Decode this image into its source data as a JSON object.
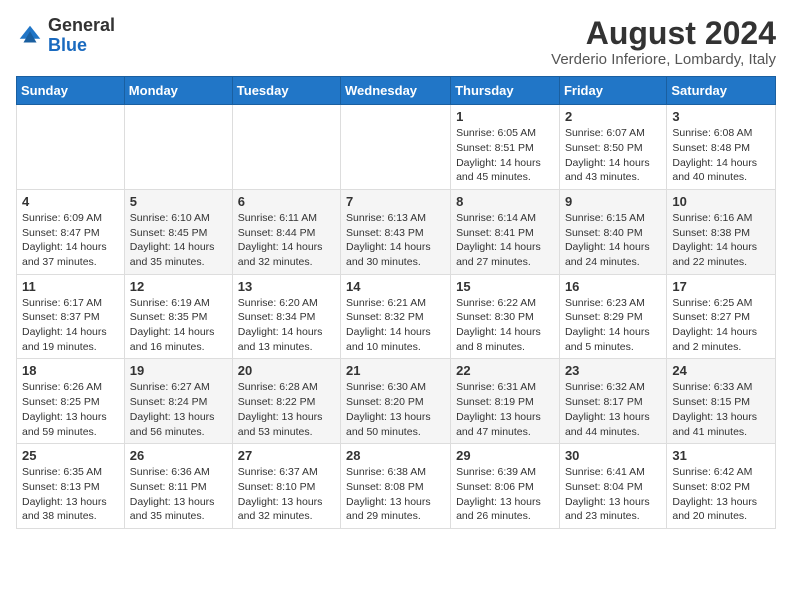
{
  "logo": {
    "text_general": "General",
    "text_blue": "Blue"
  },
  "header": {
    "month_year": "August 2024",
    "location": "Verderio Inferiore, Lombardy, Italy"
  },
  "weekdays": [
    "Sunday",
    "Monday",
    "Tuesday",
    "Wednesday",
    "Thursday",
    "Friday",
    "Saturday"
  ],
  "weeks": [
    [
      {
        "day": "",
        "info": ""
      },
      {
        "day": "",
        "info": ""
      },
      {
        "day": "",
        "info": ""
      },
      {
        "day": "",
        "info": ""
      },
      {
        "day": "1",
        "info": "Sunrise: 6:05 AM\nSunset: 8:51 PM\nDaylight: 14 hours and 45 minutes."
      },
      {
        "day": "2",
        "info": "Sunrise: 6:07 AM\nSunset: 8:50 PM\nDaylight: 14 hours and 43 minutes."
      },
      {
        "day": "3",
        "info": "Sunrise: 6:08 AM\nSunset: 8:48 PM\nDaylight: 14 hours and 40 minutes."
      }
    ],
    [
      {
        "day": "4",
        "info": "Sunrise: 6:09 AM\nSunset: 8:47 PM\nDaylight: 14 hours and 37 minutes."
      },
      {
        "day": "5",
        "info": "Sunrise: 6:10 AM\nSunset: 8:45 PM\nDaylight: 14 hours and 35 minutes."
      },
      {
        "day": "6",
        "info": "Sunrise: 6:11 AM\nSunset: 8:44 PM\nDaylight: 14 hours and 32 minutes."
      },
      {
        "day": "7",
        "info": "Sunrise: 6:13 AM\nSunset: 8:43 PM\nDaylight: 14 hours and 30 minutes."
      },
      {
        "day": "8",
        "info": "Sunrise: 6:14 AM\nSunset: 8:41 PM\nDaylight: 14 hours and 27 minutes."
      },
      {
        "day": "9",
        "info": "Sunrise: 6:15 AM\nSunset: 8:40 PM\nDaylight: 14 hours and 24 minutes."
      },
      {
        "day": "10",
        "info": "Sunrise: 6:16 AM\nSunset: 8:38 PM\nDaylight: 14 hours and 22 minutes."
      }
    ],
    [
      {
        "day": "11",
        "info": "Sunrise: 6:17 AM\nSunset: 8:37 PM\nDaylight: 14 hours and 19 minutes."
      },
      {
        "day": "12",
        "info": "Sunrise: 6:19 AM\nSunset: 8:35 PM\nDaylight: 14 hours and 16 minutes."
      },
      {
        "day": "13",
        "info": "Sunrise: 6:20 AM\nSunset: 8:34 PM\nDaylight: 14 hours and 13 minutes."
      },
      {
        "day": "14",
        "info": "Sunrise: 6:21 AM\nSunset: 8:32 PM\nDaylight: 14 hours and 10 minutes."
      },
      {
        "day": "15",
        "info": "Sunrise: 6:22 AM\nSunset: 8:30 PM\nDaylight: 14 hours and 8 minutes."
      },
      {
        "day": "16",
        "info": "Sunrise: 6:23 AM\nSunset: 8:29 PM\nDaylight: 14 hours and 5 minutes."
      },
      {
        "day": "17",
        "info": "Sunrise: 6:25 AM\nSunset: 8:27 PM\nDaylight: 14 hours and 2 minutes."
      }
    ],
    [
      {
        "day": "18",
        "info": "Sunrise: 6:26 AM\nSunset: 8:25 PM\nDaylight: 13 hours and 59 minutes."
      },
      {
        "day": "19",
        "info": "Sunrise: 6:27 AM\nSunset: 8:24 PM\nDaylight: 13 hours and 56 minutes."
      },
      {
        "day": "20",
        "info": "Sunrise: 6:28 AM\nSunset: 8:22 PM\nDaylight: 13 hours and 53 minutes."
      },
      {
        "day": "21",
        "info": "Sunrise: 6:30 AM\nSunset: 8:20 PM\nDaylight: 13 hours and 50 minutes."
      },
      {
        "day": "22",
        "info": "Sunrise: 6:31 AM\nSunset: 8:19 PM\nDaylight: 13 hours and 47 minutes."
      },
      {
        "day": "23",
        "info": "Sunrise: 6:32 AM\nSunset: 8:17 PM\nDaylight: 13 hours and 44 minutes."
      },
      {
        "day": "24",
        "info": "Sunrise: 6:33 AM\nSunset: 8:15 PM\nDaylight: 13 hours and 41 minutes."
      }
    ],
    [
      {
        "day": "25",
        "info": "Sunrise: 6:35 AM\nSunset: 8:13 PM\nDaylight: 13 hours and 38 minutes."
      },
      {
        "day": "26",
        "info": "Sunrise: 6:36 AM\nSunset: 8:11 PM\nDaylight: 13 hours and 35 minutes."
      },
      {
        "day": "27",
        "info": "Sunrise: 6:37 AM\nSunset: 8:10 PM\nDaylight: 13 hours and 32 minutes."
      },
      {
        "day": "28",
        "info": "Sunrise: 6:38 AM\nSunset: 8:08 PM\nDaylight: 13 hours and 29 minutes."
      },
      {
        "day": "29",
        "info": "Sunrise: 6:39 AM\nSunset: 8:06 PM\nDaylight: 13 hours and 26 minutes."
      },
      {
        "day": "30",
        "info": "Sunrise: 6:41 AM\nSunset: 8:04 PM\nDaylight: 13 hours and 23 minutes."
      },
      {
        "day": "31",
        "info": "Sunrise: 6:42 AM\nSunset: 8:02 PM\nDaylight: 13 hours and 20 minutes."
      }
    ]
  ]
}
